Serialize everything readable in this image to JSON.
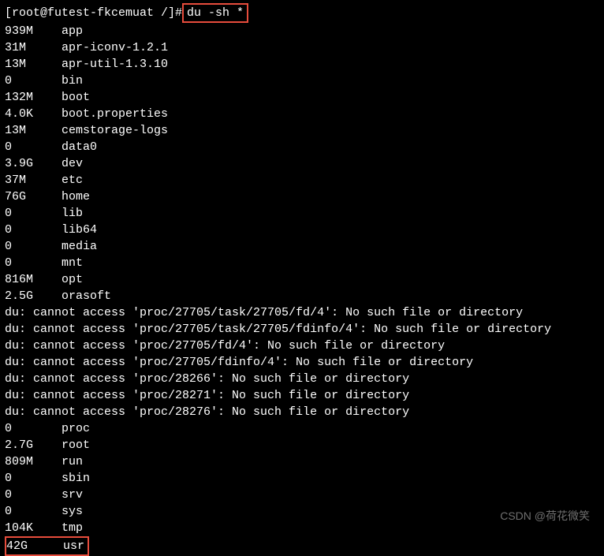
{
  "prompt": {
    "text": "[root@futest-fkcemuat /]# ",
    "command": "du -sh *"
  },
  "entries_top": [
    {
      "size": "939M",
      "name": "app"
    },
    {
      "size": "31M",
      "name": "apr-iconv-1.2.1"
    },
    {
      "size": "13M",
      "name": "apr-util-1.3.10"
    },
    {
      "size": "0",
      "name": "bin"
    },
    {
      "size": "132M",
      "name": "boot"
    },
    {
      "size": "4.0K",
      "name": "boot.properties"
    },
    {
      "size": "13M",
      "name": "cemstorage-logs"
    },
    {
      "size": "0",
      "name": "data0"
    },
    {
      "size": "3.9G",
      "name": "dev"
    },
    {
      "size": "37M",
      "name": "etc"
    },
    {
      "size": "76G",
      "name": "home"
    },
    {
      "size": "0",
      "name": "lib"
    },
    {
      "size": "0",
      "name": "lib64"
    },
    {
      "size": "0",
      "name": "media"
    },
    {
      "size": "0",
      "name": "mnt"
    },
    {
      "size": "816M",
      "name": "opt"
    },
    {
      "size": "2.5G",
      "name": "orasoft"
    }
  ],
  "errors": [
    "du: cannot access 'proc/27705/task/27705/fd/4': No such file or directory",
    "du: cannot access 'proc/27705/task/27705/fdinfo/4': No such file or directory",
    "du: cannot access 'proc/27705/fd/4': No such file or directory",
    "du: cannot access 'proc/27705/fdinfo/4': No such file or directory",
    "du: cannot access 'proc/28266': No such file or directory",
    "du: cannot access 'proc/28271': No such file or directory",
    "du: cannot access 'proc/28276': No such file or directory"
  ],
  "entries_bottom": [
    {
      "size": "0",
      "name": "proc"
    },
    {
      "size": "2.7G",
      "name": "root"
    },
    {
      "size": "809M",
      "name": "run"
    },
    {
      "size": "0",
      "name": "sbin"
    },
    {
      "size": "0",
      "name": "srv"
    },
    {
      "size": "0",
      "name": "sys"
    },
    {
      "size": "104K",
      "name": "tmp"
    }
  ],
  "highlighted_entry": {
    "size": "42G",
    "name": "usr"
  },
  "watermark": "CSDN @荷花微笑"
}
